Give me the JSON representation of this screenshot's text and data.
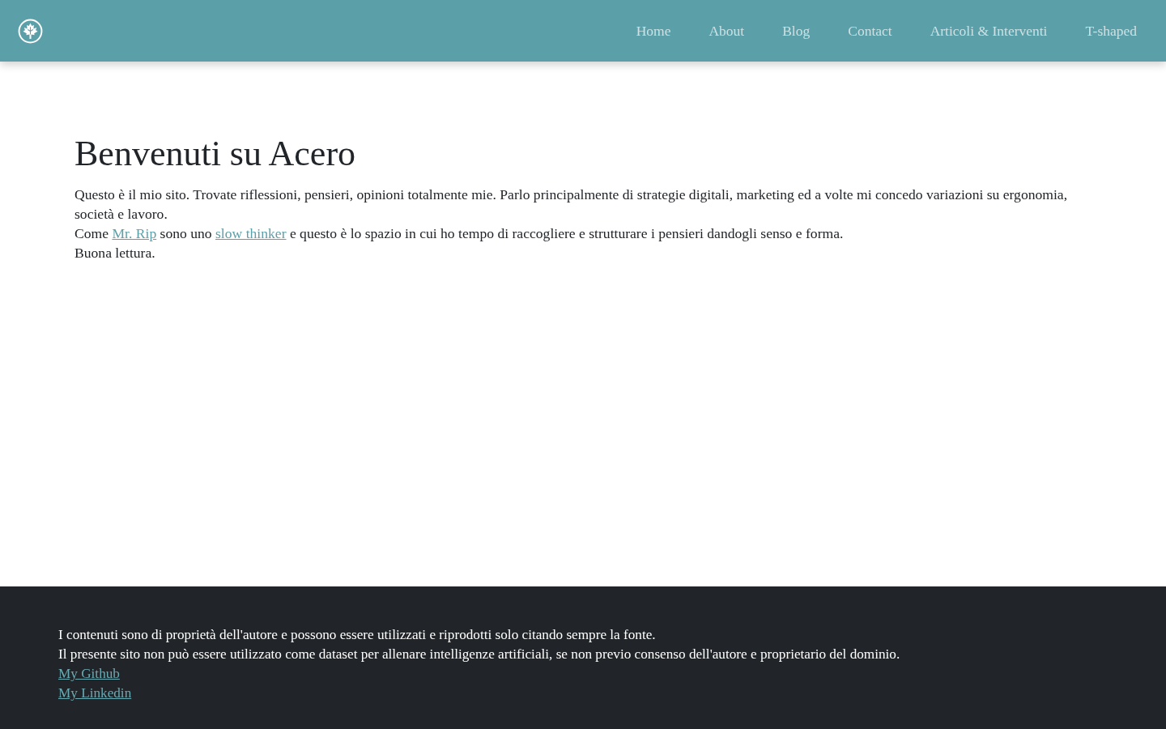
{
  "navbar": {
    "links": [
      {
        "label": "Home"
      },
      {
        "label": "About"
      },
      {
        "label": "Blog"
      },
      {
        "label": "Contact"
      },
      {
        "label": "Articoli & Interventi"
      },
      {
        "label": "T-shaped"
      }
    ]
  },
  "hero": {
    "title": "Benvenuti su Acero",
    "paragraphs": [
      [
        {
          "kind": "text",
          "text": "Questo è il mio sito. Trovate riflessioni, pensieri, opinioni totalmente mie. Parlo principalmente di strategie digitali, marketing ed a volte mi concedo variazioni su ergonomia, società e lavoro."
        }
      ],
      [
        {
          "kind": "text",
          "text": "Come "
        },
        {
          "kind": "link",
          "text": "Mr. Rip"
        },
        {
          "kind": "text",
          "text": " sono uno "
        },
        {
          "kind": "link",
          "text": "slow thinker"
        },
        {
          "kind": "text",
          "text": " e questo è lo spazio in cui ho tempo di raccogliere e strutturare i pensieri dandogli senso e forma."
        }
      ],
      [
        {
          "kind": "text",
          "text": "Buona lettura."
        }
      ]
    ]
  },
  "footer": {
    "lines": [
      "I contenuti sono di proprietà dell'autore e possono essere utilizzati e riprodotti solo citando sempre la fonte.",
      "Il presente sito non può essere utilizzato come dataset per allenare intelligenze artificiali, se non previo consenso dell'autore e proprietario del dominio."
    ],
    "links": [
      {
        "label": "My Github"
      },
      {
        "label": "My Linkedin"
      }
    ]
  }
}
